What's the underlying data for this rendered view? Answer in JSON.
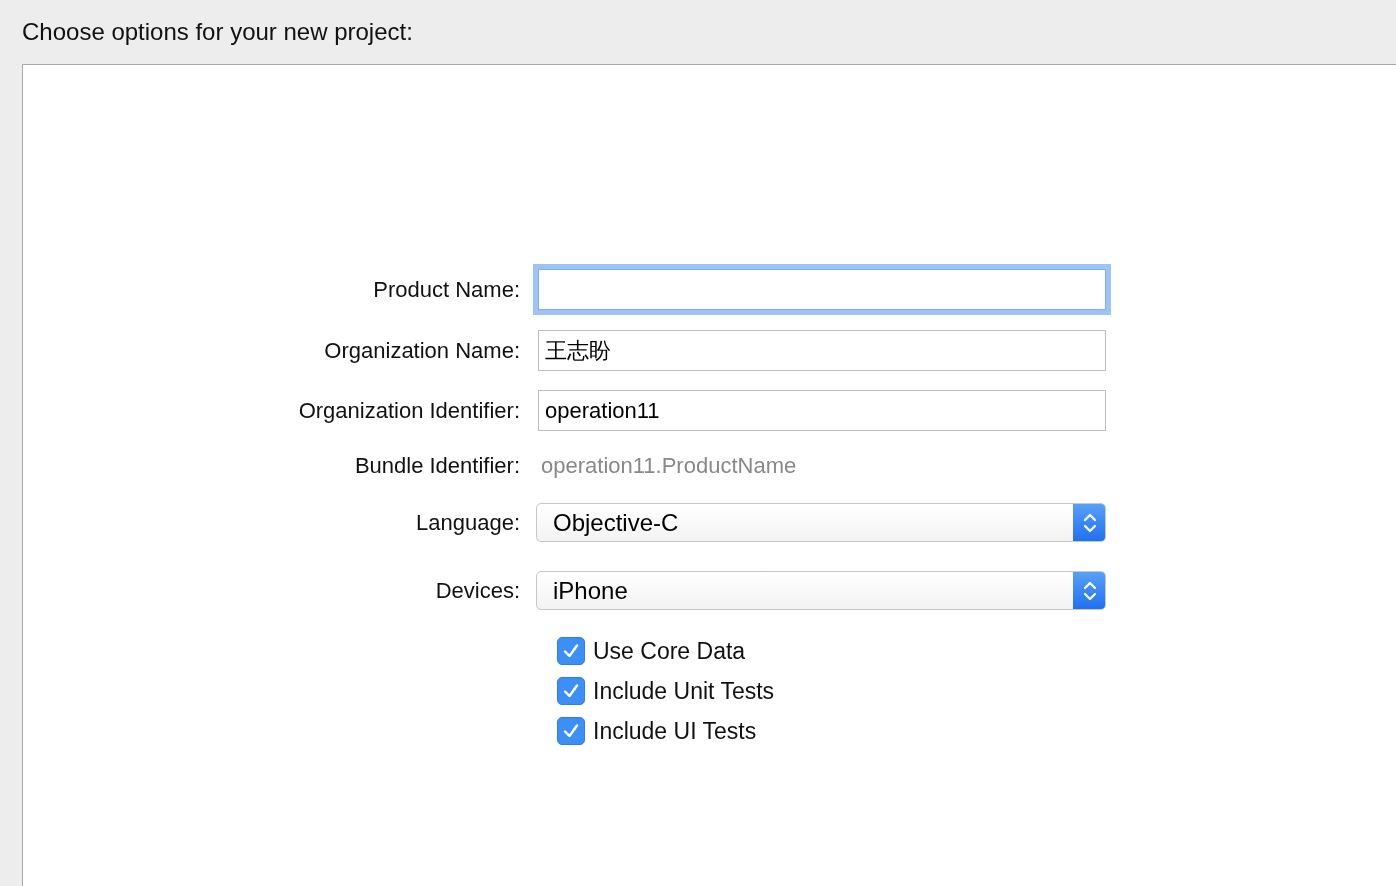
{
  "header": {
    "title": "Choose options for your new project:"
  },
  "fields": [
    {
      "kind": "input",
      "label": "Product Name:",
      "focused": true
    },
    {
      "kind": "input",
      "label": "Organization Name:",
      "value": "王志盼",
      "focused": false
    },
    {
      "kind": "input",
      "label": "Organization Identifier:",
      "value": "operation11",
      "focused": false
    },
    {
      "kind": "static",
      "label": "Bundle Identifier:",
      "value": "operation11.ProductName"
    },
    {
      "kind": "select",
      "label": "Language:",
      "value": "Objective-C"
    },
    {
      "kind": "select",
      "label": "Devices:",
      "value": "iPhone"
    }
  ],
  "options": [
    {
      "label": "Use Core Data",
      "checked": true
    },
    {
      "label": "Include Unit Tests",
      "checked": true
    },
    {
      "label": "Include UI Tests",
      "checked": true
    }
  ]
}
